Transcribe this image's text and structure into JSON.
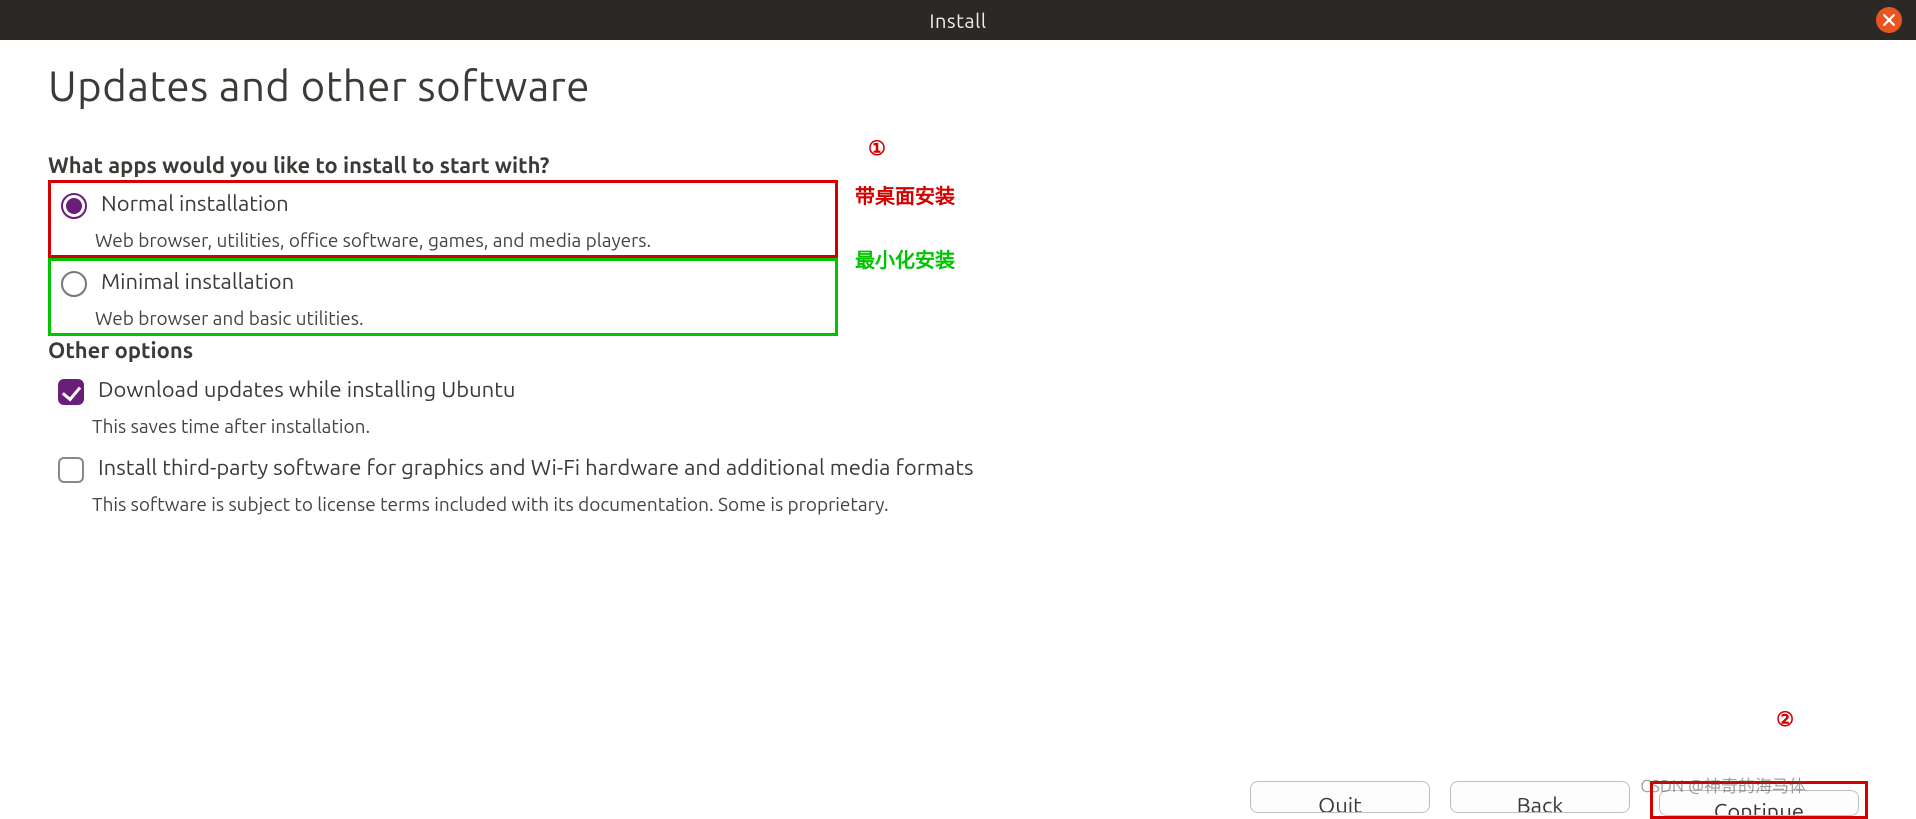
{
  "window": {
    "title": "Install"
  },
  "page": {
    "heading": "Updates and other software",
    "question": "What apps would you like to install to start with?",
    "other_options": "Other options"
  },
  "install_type": {
    "normal": {
      "label": "Normal installation",
      "desc": "Web browser, utilities, office software, games, and media players."
    },
    "minimal": {
      "label": "Minimal installation",
      "desc": "Web browser and basic utilities."
    }
  },
  "options": {
    "download_updates": {
      "label": "Download updates while installing Ubuntu",
      "desc": "This saves time after installation."
    },
    "third_party": {
      "label": "Install third-party software for graphics and Wi-Fi hardware and additional media formats",
      "desc": "This software is subject to license terms included with its documentation. Some is proprietary."
    }
  },
  "buttons": {
    "quit": "Quit",
    "back": "Back",
    "continue": "Continue"
  },
  "annotations": {
    "num1": "①",
    "num2": "②",
    "normal_note": "带桌面安装",
    "minimal_note": "最小化安装"
  },
  "watermark": "CSDN @神奇的海马体"
}
